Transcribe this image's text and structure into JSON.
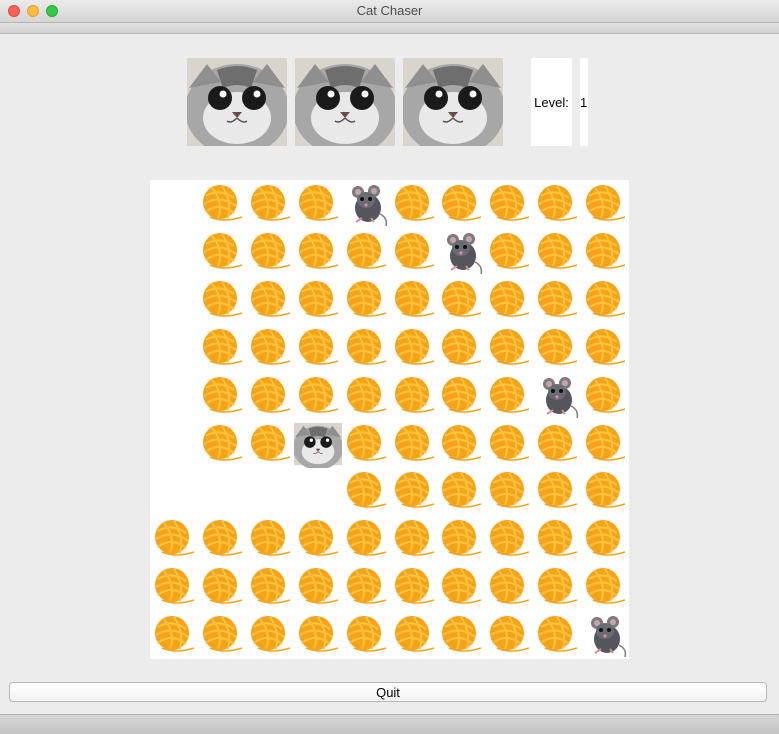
{
  "window": {
    "title": "Cat Chaser"
  },
  "lives": {
    "count": 3,
    "icon": "cat-face-icon"
  },
  "level": {
    "label": "Level:",
    "value": "1"
  },
  "board": {
    "rows": 10,
    "cols": 10,
    "legend": {
      "Y": "yarn-ball-icon",
      "M": "mouse-icon",
      "C": "cat-icon",
      ".": "empty"
    },
    "grid": [
      ".YYYMYYYYY",
      ".YYYYYMYYY",
      ".YYYYYYYYY",
      ".YYYYYYYYY",
      ".YYYYYYYMY",
      ".YYCYYYYYY",
      "....YYYYYY",
      "YYYYYYYYYY",
      "YYYYYYYYYY",
      "YYYYYYYYYM"
    ]
  },
  "buttons": {
    "quit": "Quit"
  },
  "colors": {
    "yarn": "#f5a31a",
    "yarn_light": "#ffc23d",
    "mouse": "#55555d",
    "cat_fur": "#a7a7a7",
    "board_bg": "#ffffff"
  }
}
